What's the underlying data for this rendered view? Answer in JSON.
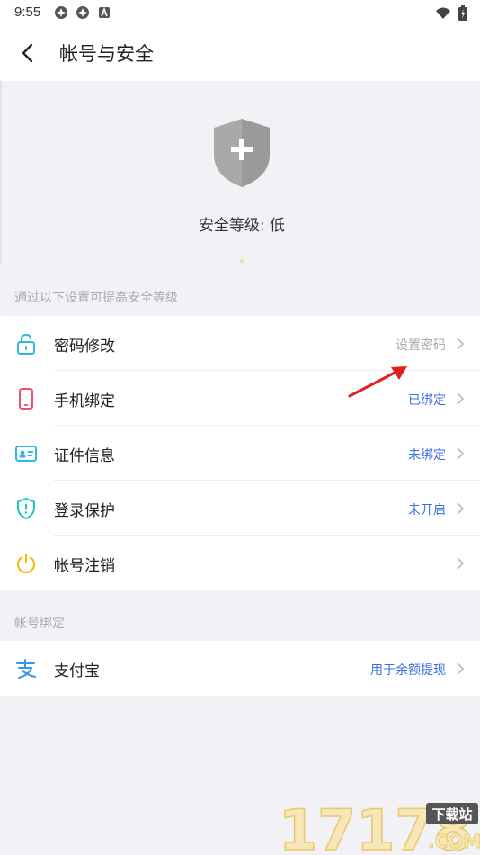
{
  "status_bar": {
    "time": "9:55"
  },
  "header": {
    "title": "帐号与安全"
  },
  "hero": {
    "security_level": "安全等级: 低"
  },
  "section1": {
    "label": "通过以下设置可提高安全等级",
    "rows": [
      {
        "label": "密码修改",
        "value": "设置密码",
        "icon": "unlock-icon"
      },
      {
        "label": "手机绑定",
        "value": "已绑定",
        "icon": "phone-icon"
      },
      {
        "label": "证件信息",
        "value": "未绑定",
        "icon": "id-card-icon"
      },
      {
        "label": "登录保护",
        "value": "未开启",
        "icon": "shield-alert-icon"
      },
      {
        "label": "帐号注销",
        "value": "",
        "icon": "power-icon"
      }
    ]
  },
  "section2": {
    "label": "帐号绑定",
    "rows": [
      {
        "label": "支付宝",
        "value": "用于余额提现",
        "icon": "alipay-icon"
      }
    ]
  },
  "watermark": {
    "number": "17178",
    "tag": "下载站",
    "suffix": ".COM"
  },
  "colors": {
    "accent_blue": "#3b6fe0",
    "background": "#f2f2f6",
    "annotation_red": "#e02020"
  }
}
